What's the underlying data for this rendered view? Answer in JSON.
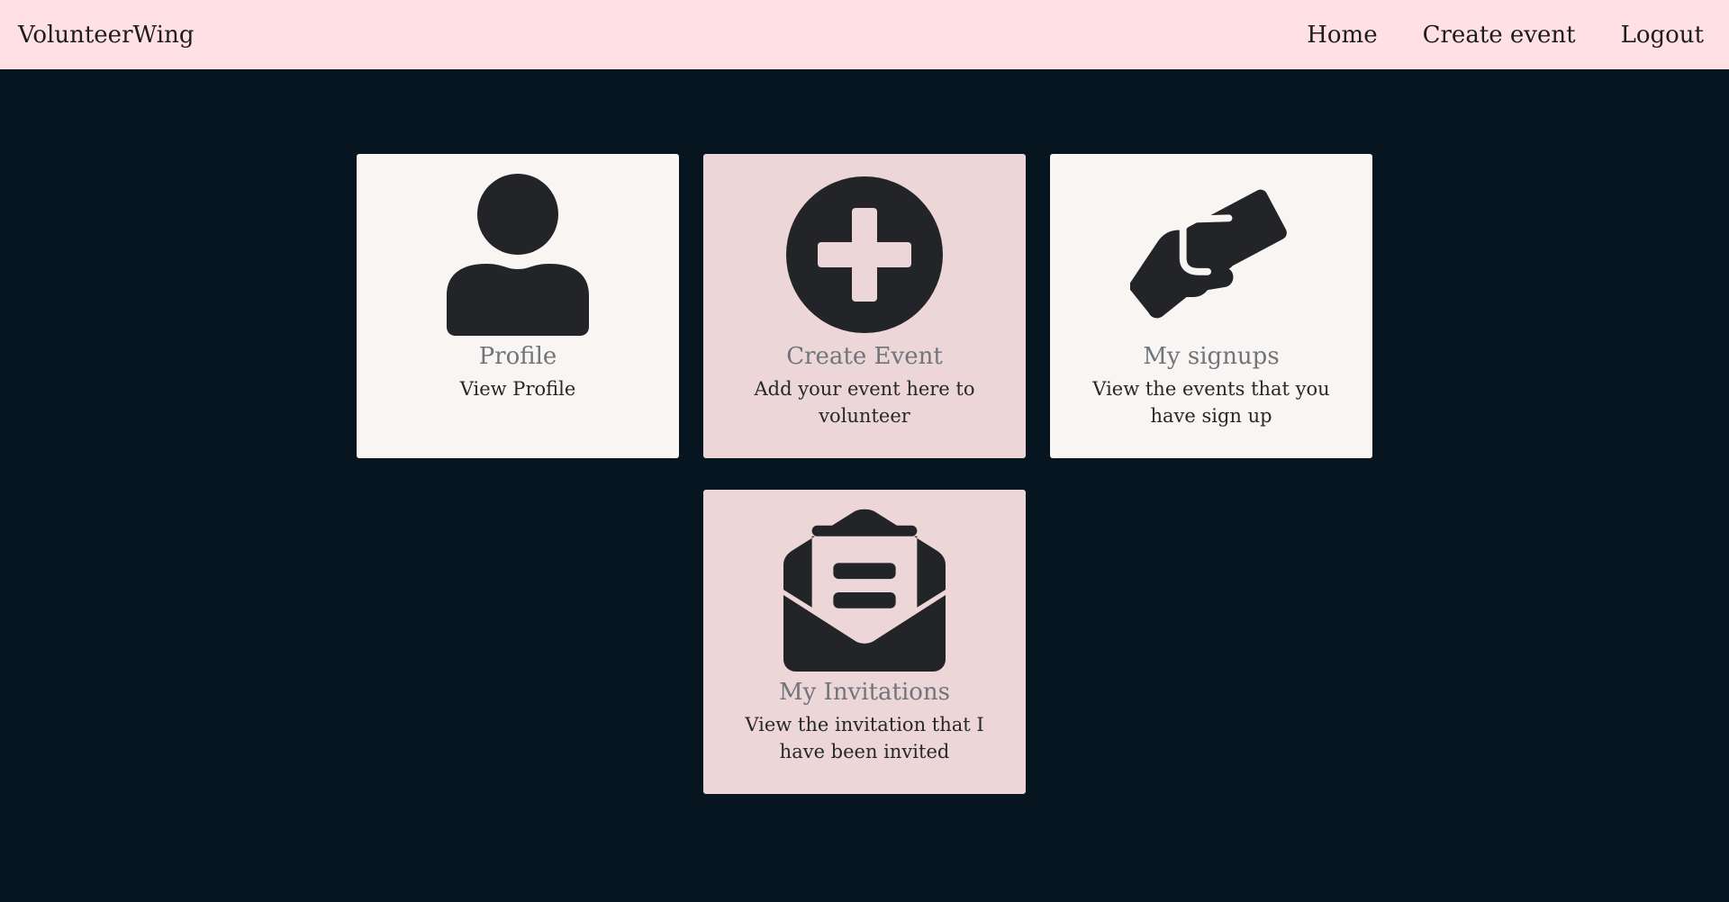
{
  "navbar": {
    "brand": "VolunteerWing",
    "links": [
      {
        "label": "Home"
      },
      {
        "label": "Create event"
      },
      {
        "label": "Logout"
      }
    ]
  },
  "cards": [
    {
      "icon": "person-icon",
      "title": "Profile",
      "text": "View Profile"
    },
    {
      "icon": "plus-circle-icon",
      "title": "Create Event",
      "text": "Add your event here to volunteer"
    },
    {
      "icon": "handshake-icon",
      "title": "My signups",
      "text": "View the events that you have sign up"
    },
    {
      "icon": "envelope-open-icon",
      "title": "My Invitations",
      "text": "View the invitation that I have been invited"
    }
  ],
  "colors": {
    "navbar_bg": "#ffe0e4",
    "page_bg": "#061520",
    "card_light": "#f8f5f2",
    "card_pink": "#ecd6d7",
    "icon": "#222428",
    "title": "#70757c"
  }
}
